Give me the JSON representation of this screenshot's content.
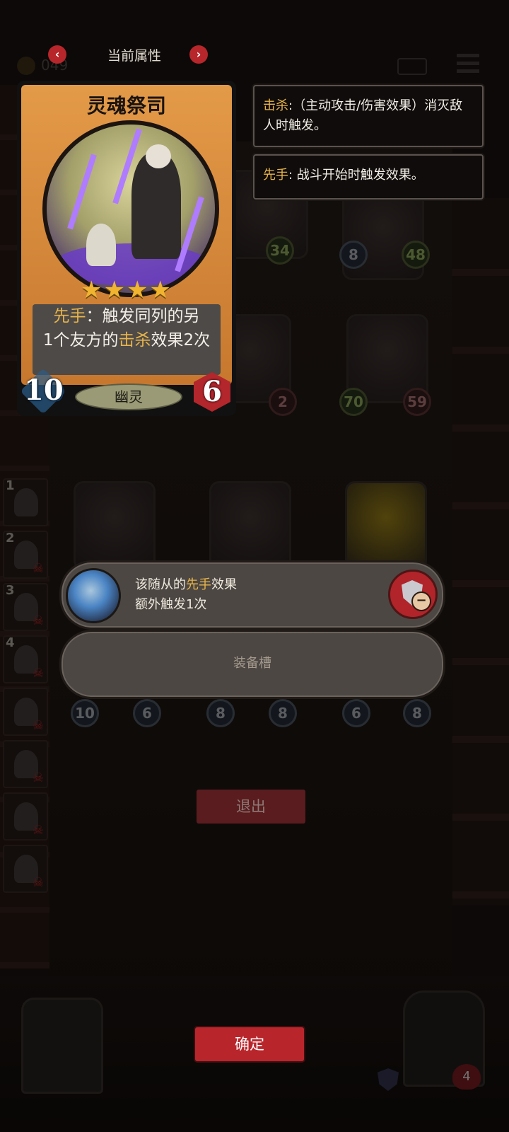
{
  "header": {
    "title": "当前属性",
    "coins": "049"
  },
  "card": {
    "name": "灵魂祭司",
    "stars": "★★★★",
    "ability_keyword": "先手",
    "ability_sep": "：",
    "ability_line1_rest": "触发同列的另",
    "ability_line2_pre": "1个友方的",
    "ability_line2_keyword": "击杀",
    "ability_line2_post": "效果2次",
    "attack": "10",
    "health": "6",
    "tribe": "幽灵"
  },
  "tooltips": [
    {
      "keyword": "击杀",
      "text": ":（主动攻击/伤害效果）消灭敌人时触发。"
    },
    {
      "keyword": "先手",
      "text": ": 战斗开始时触发效果。"
    }
  ],
  "roster": [
    "1",
    "2",
    "3",
    "4",
    "",
    "",
    "",
    ""
  ],
  "board": {
    "row1": [
      {
        "atk": "",
        "hp": "34"
      },
      {
        "atk": "8",
        "hp": "48"
      }
    ],
    "row2": [
      {
        "atk": "",
        "hp": "2"
      },
      {
        "atk": "70",
        "hp": "59"
      }
    ],
    "row4": [
      {
        "atk": "10",
        "hp": "6"
      },
      {
        "atk": "8",
        "hp": "8"
      },
      {
        "atk": "6",
        "hp": "8"
      }
    ]
  },
  "equipment": {
    "slot1_line1_pre": "该随从的",
    "slot1_keyword": "先手",
    "slot1_line1_post": "效果",
    "slot1_line2": "额外触发1次",
    "slot2_label": "装备槽"
  },
  "buttons": {
    "exit": "退出",
    "confirm": "确定"
  },
  "player_hp": "4",
  "colors": {
    "accent_red": "#b8262c",
    "keyword_gold": "#e8b54a",
    "card_frame": "#d98a3e"
  }
}
